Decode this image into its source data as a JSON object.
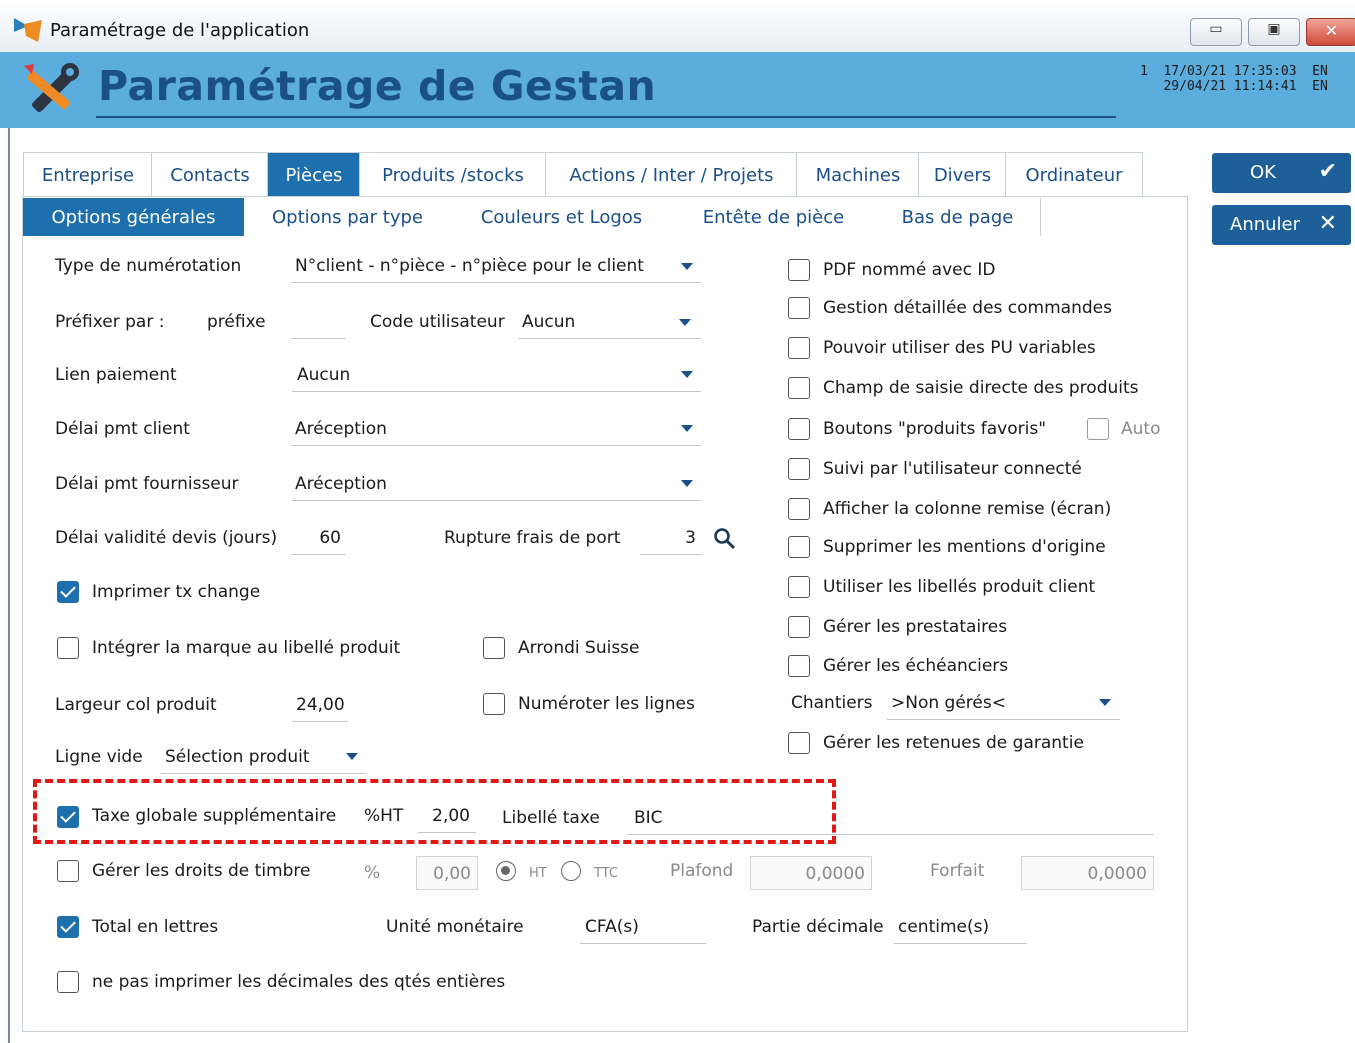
{
  "window": {
    "title": "Paramétrage de l'application",
    "min": "▭",
    "max": "▣",
    "close": "✕"
  },
  "header": {
    "title": "Paramétrage de Gestan",
    "stamp1": "1  17/03/21 17:35:03  EN",
    "stamp2": "   29/04/21 11:14:41  EN"
  },
  "tabs": [
    "Entreprise",
    "Contacts",
    "Pièces",
    "Produits /stocks",
    "Actions / Inter / Projets",
    "Machines",
    "Divers",
    "Ordinateur"
  ],
  "subtabs": [
    "Options générales",
    "Options par type",
    "Couleurs et Logos",
    "Entête de pièce",
    "Bas de page"
  ],
  "buttons": {
    "ok": "OK",
    "ok_icon": "✔",
    "cancel": "Annuler",
    "cancel_icon": "✕"
  },
  "form": {
    "numerotation_label": "Type de numérotation",
    "numerotation_value": "N°client - n°pièce - n°pièce pour le client",
    "prefixer_label": "Préfixer par :",
    "prefixe_label": "préfixe",
    "prefixe_value": "",
    "code_user_label": "Code utilisateur",
    "code_user_value": "Aucun",
    "lien_label": "Lien paiement",
    "lien_value": "Aucun",
    "delai_client_label": "Délai pmt client",
    "delai_client_value": "Aréception",
    "delai_fourn_label": "Délai pmt fournisseur",
    "delai_fourn_value": "Aréception",
    "validite_label": "Délai validité devis (jours)",
    "validite_value": "60",
    "rupture_label": "Rupture frais de port",
    "rupture_value": "3",
    "tx_change_label": "Imprimer tx change",
    "marque_label": "Intégrer la marque au libellé produit",
    "arrondi_label": "Arrondi Suisse",
    "largeur_label": "Largeur col produit",
    "largeur_value": "24,00",
    "numeroter_label": "Numéroter les lignes",
    "ligne_vide_label": "Ligne vide",
    "ligne_vide_value": "Sélection produit",
    "taxe_label": "Taxe globale supplémentaire",
    "taxe_ht_label": "%HT",
    "taxe_ht_value": "2,00",
    "libelle_taxe_label": "Libellé taxe",
    "libelle_taxe_value": "BIC",
    "timbre_label": "Gérer les droits de timbre",
    "timbre_pct_label": "%",
    "timbre_pct_value": "0,00",
    "ht_label": "HT",
    "ttc_label": "TTC",
    "plafond_label": "Plafond",
    "plafond_value": "0,0000",
    "forfait_label": "Forfait",
    "forfait_value": "0,0000",
    "total_lettres_label": "Total en lettres",
    "unite_label": "Unité monétaire",
    "unite_value": "CFA(s)",
    "partie_label": "Partie décimale",
    "partie_value": "centime(s)",
    "decimales_label": "ne pas imprimer les décimales des qtés entières"
  },
  "right_options": [
    "PDF nommé avec ID",
    "Gestion détaillée des commandes",
    "Pouvoir utiliser des PU variables",
    "Champ de saisie directe des produits",
    "Boutons \"produits favoris\"",
    "Suivi par l'utilisateur connecté",
    "Afficher la colonne remise (écran)",
    "Supprimer les mentions d'origine",
    "Utiliser les libellés produit client",
    "Gérer les prestataires",
    "Gérer les échéanciers"
  ],
  "auto_label": "Auto",
  "chantiers": {
    "label": "Chantiers",
    "value": ">Non gérés<"
  },
  "retenues_label": "Gérer les retenues de garantie",
  "colors": {
    "accent": "#1d6fae",
    "header": "#5aaddc",
    "highlight": "#e01818"
  }
}
